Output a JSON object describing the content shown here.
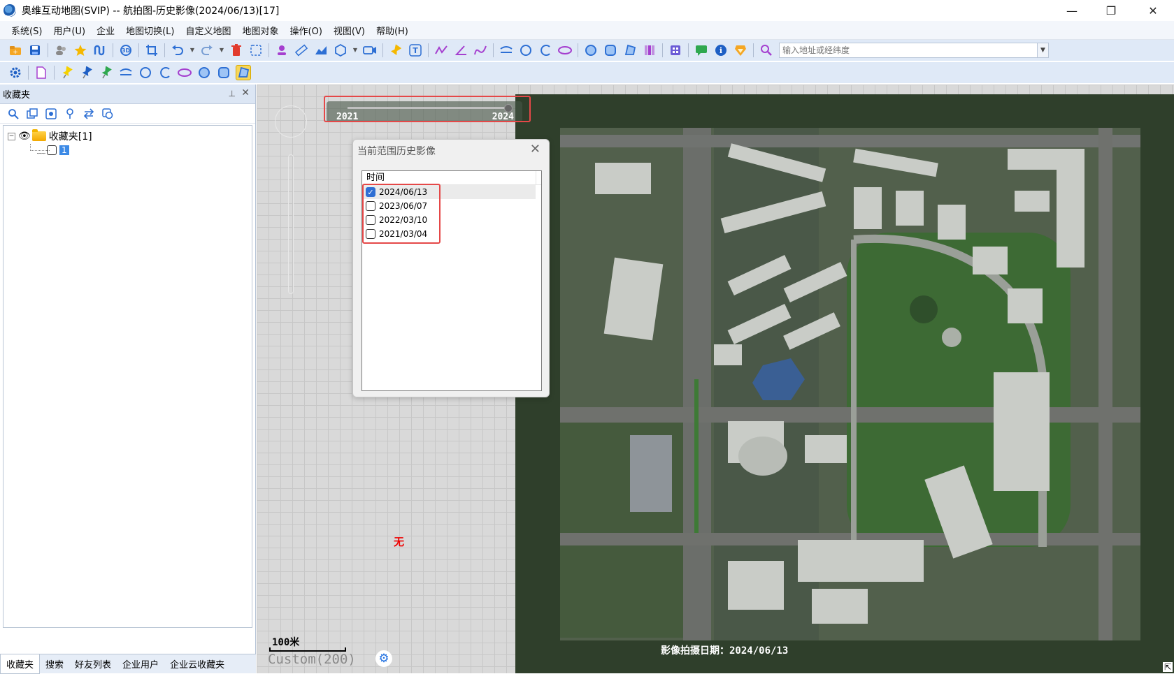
{
  "window": {
    "title": "奥维互动地图(SVIP) -- 航拍图-历史影像(2024/06/13)[17]",
    "minimize_glyph": "—",
    "maximize_glyph": "❐",
    "close_glyph": "✕"
  },
  "menu": {
    "items": [
      "系统(S)",
      "用户(U)",
      "企业",
      "地图切换(L)",
      "自定义地图",
      "地图对象",
      "操作(O)",
      "视图(V)",
      "帮助(H)"
    ]
  },
  "toolbar": {
    "address_placeholder": "输入地址或经纬度",
    "dropdown_glyph": "▼"
  },
  "left_panel": {
    "title": "收藏夹",
    "pin_glyph": "⊥",
    "close_glyph": "✕",
    "tree": {
      "expander": "−",
      "folder_label": "收藏夹[1]",
      "child_label": "1"
    },
    "bottom_tabs": [
      "收藏夹",
      "搜索",
      "好友列表",
      "企业用户",
      "企业云收藏夹"
    ],
    "active_tab": "收藏夹"
  },
  "map": {
    "no_image_label": "无",
    "capture_date_label": "影像拍摄日期：2024/06/13",
    "scale_label": "100米",
    "zoom_level_label": "Custom(200)",
    "settings_glyph": "⚙",
    "resize_glyph": "⇱",
    "year_slider": {
      "start_label": "2021",
      "end_label": "2024",
      "position": 1.0
    }
  },
  "dialog": {
    "title": "当前范围历史影像",
    "close_glyph": "✕",
    "column_header": "时间",
    "rows": [
      {
        "date": "2024/06/13",
        "checked": true
      },
      {
        "date": "2023/06/07",
        "checked": false
      },
      {
        "date": "2022/03/10",
        "checked": false
      },
      {
        "date": "2021/03/04",
        "checked": false
      }
    ]
  },
  "colors": {
    "accent": "#2f6fd4",
    "highlight_border": "#e54848",
    "dark_map_bg": "#2f3f2b"
  }
}
